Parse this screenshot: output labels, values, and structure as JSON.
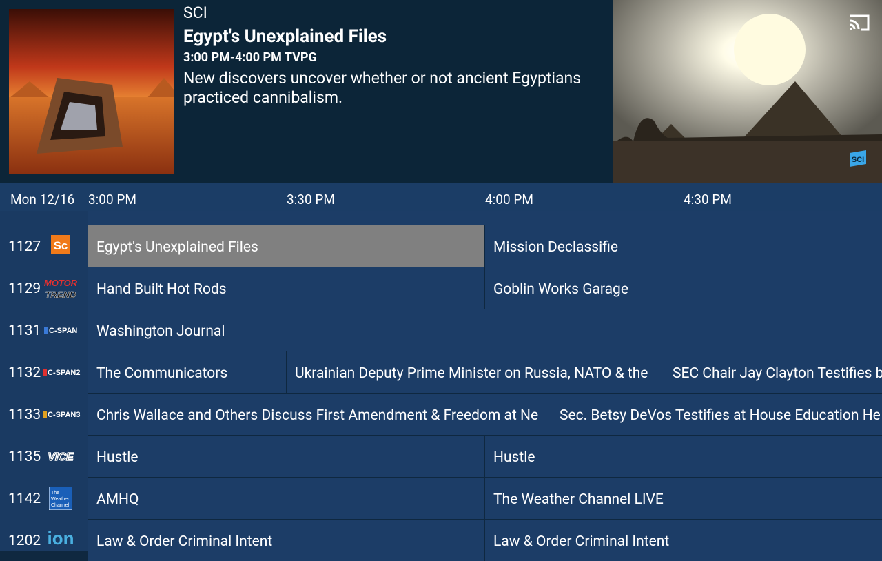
{
  "header": {
    "channel_code": "SCI",
    "title": "Egypt's Unexplained Files",
    "time_rating": "3:00 PM-4:00 PM TVPG",
    "description": "New discovers uncover whether or not ancient Egyptians practiced cannibalism.",
    "badge_text": "SCI"
  },
  "timeline": {
    "date": "Mon 12/16",
    "times": [
      "3:00 PM",
      "3:30 PM",
      "4:00 PM",
      "4:30 PM"
    ]
  },
  "channels": [
    {
      "number": "1127",
      "logo": "science-logo",
      "logo_text": "Sc",
      "programs": [
        "Egypt's Unexplained Files",
        "Mission Declassifie"
      ]
    },
    {
      "number": "1129",
      "logo": "motor-trend-logo",
      "logo_text": "MOTOR TREND",
      "programs": [
        "Hand Built Hot Rods",
        "Goblin Works Garage"
      ]
    },
    {
      "number": "1131",
      "logo": "cspan-logo",
      "logo_text": "C-SPAN",
      "programs": [
        "Washington Journal"
      ]
    },
    {
      "number": "1132",
      "logo": "cspan2-logo",
      "logo_text": "C-SPAN2",
      "programs": [
        "The Communicators",
        "Ukrainian Deputy Prime Minister on Russia, NATO & the",
        "SEC Chair Jay Clayton Testifies b"
      ]
    },
    {
      "number": "1133",
      "logo": "cspan3-logo",
      "logo_text": "C-SPAN3",
      "programs": [
        "Chris Wallace and Others Discuss First Amendment & Freedom at Ne",
        "Sec. Betsy DeVos Testifies at House Education He"
      ]
    },
    {
      "number": "1135",
      "logo": "vice-logo",
      "logo_text": "VICE",
      "programs": [
        "Hustle",
        "Hustle"
      ]
    },
    {
      "number": "1142",
      "logo": "weather-channel-logo",
      "logo_text": "The Weather Channel",
      "programs": [
        "AMHQ",
        "The Weather Channel LIVE"
      ]
    },
    {
      "number": "1202",
      "logo": "ion-logo",
      "logo_text": "ion",
      "programs": [
        "Law & Order Criminal Intent",
        "Law & Order Criminal Intent"
      ]
    }
  ],
  "colors": {
    "header_bg": "#0c2538",
    "grid_cell": "#1c3d67",
    "selected_cell": "#808080",
    "now_line": "#d88f2a"
  }
}
